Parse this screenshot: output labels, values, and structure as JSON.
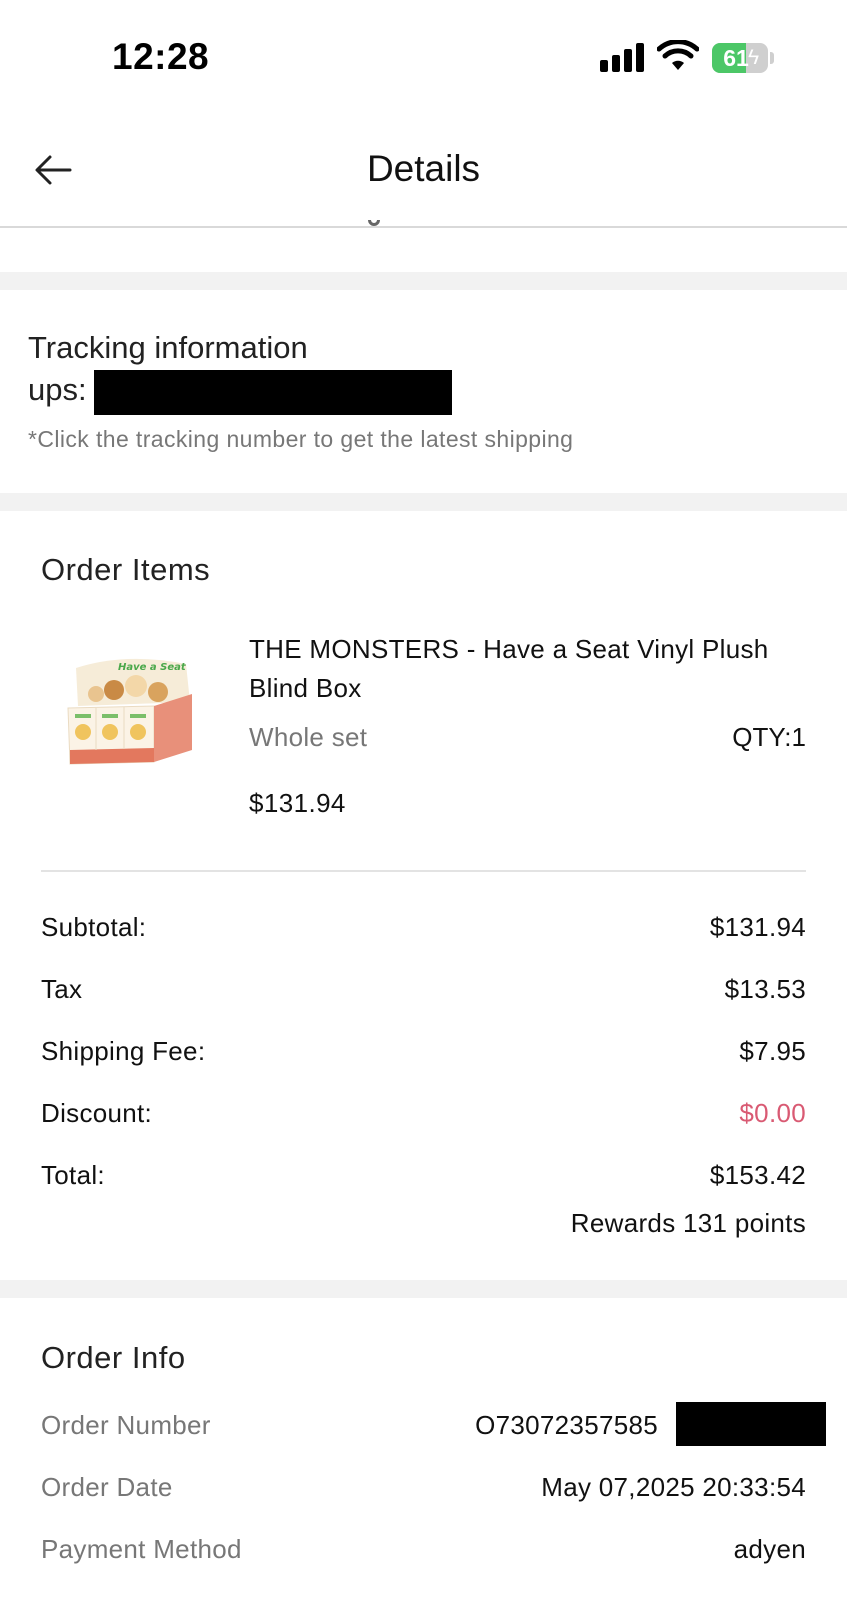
{
  "status_bar": {
    "time": "12:28",
    "battery_level": "61",
    "battery_fraction": 0.61,
    "icons": [
      "signal-icon",
      "wifi-icon",
      "battery-icon"
    ]
  },
  "header": {
    "title": "Details",
    "back_icon": "back-arrow-icon"
  },
  "tracking": {
    "title": "Tracking information",
    "carrier_label": "ups:",
    "hint": "*Click the tracking number to get the latest shipping"
  },
  "order_items": {
    "title": "Order Items",
    "items": [
      {
        "name": "THE MONSTERS - Have a Seat Vinyl Plush Blind Box",
        "variant": "Whole set",
        "qty": "QTY:1",
        "price": "$131.94",
        "thumb_logo_text": "Have a Seat"
      }
    ]
  },
  "summary": {
    "rows": [
      {
        "label": "Subtotal:",
        "value": "$131.94"
      },
      {
        "label": "Tax",
        "value": "$13.53"
      },
      {
        "label": "Shipping Fee:",
        "value": "$7.95"
      },
      {
        "label": "Discount:",
        "value": "$0.00"
      },
      {
        "label": "Total:",
        "value": "$153.42"
      }
    ],
    "rewards": "Rewards 131 points",
    "discount_color": "#d95a73"
  },
  "order_info": {
    "title": "Order Info",
    "rows": [
      {
        "label": "Order Number",
        "value": "O73072357585"
      },
      {
        "label": "Order Date",
        "value": "May 07,2025 20:33:54"
      },
      {
        "label": "Payment Method",
        "value": "adyen"
      }
    ]
  },
  "colors": {
    "battery_green": "#4cc767",
    "section_gap": "#f2f2f2",
    "muted_text": "#777777"
  }
}
